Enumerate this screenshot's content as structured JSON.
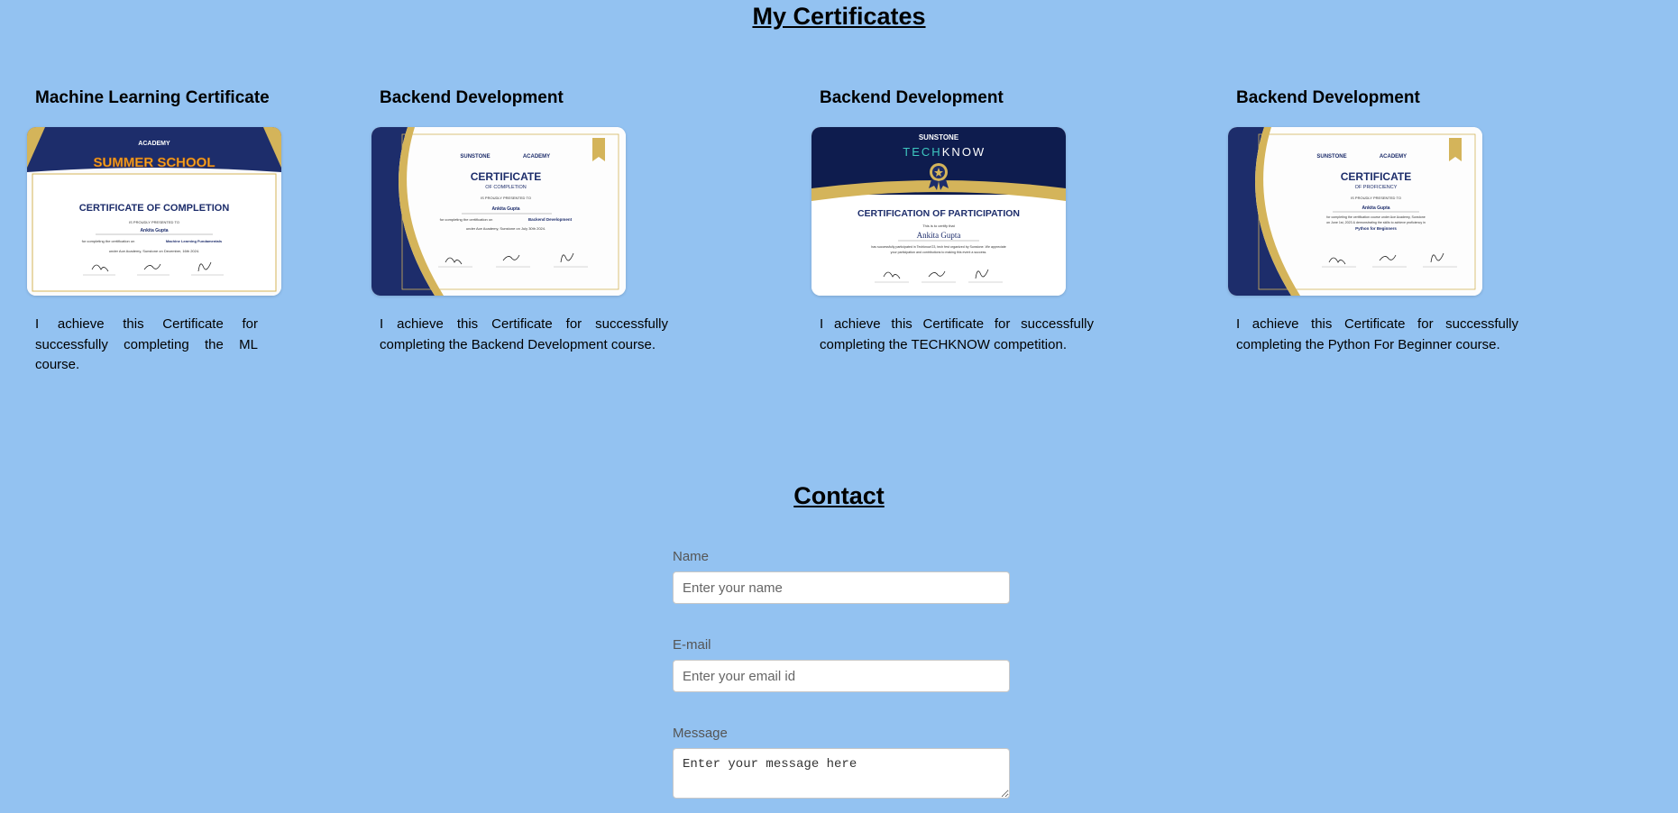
{
  "certificates_section": {
    "title": "My Certificates",
    "cards": [
      {
        "title": "Machine Learning Certificate",
        "description": "I achieve this Certificate for successfully completing the ML course.",
        "image": {
          "brand": "ACADEMY",
          "banner": "SUMMER SCHOOL",
          "heading": "CERTIFICATE OF COMPLETION",
          "presented": "IS PROUDLY PRESENTED TO",
          "name": "Ankita Gupta",
          "line": "for completing the certification on",
          "course": "Machine Learning Fundamentals",
          "footer": "under Ace Academy, Sunstone on December, 16th 2024."
        }
      },
      {
        "title": "Backend Development",
        "description": "I achieve this Certificate for successfully completing the Backend Development course.",
        "image": {
          "brand_left": "SUNSTONE",
          "brand_right": "ACADEMY",
          "heading": "CERTIFICATE",
          "subheading": "OF COMPLETION",
          "presented": "IS PROUDLY PRESENTED TO",
          "name": "Ankita Gupta",
          "line": "for completing the certification on",
          "course": "Backend Development",
          "footer": "under Ace Academy, Sunstone on July 30th 2024."
        }
      },
      {
        "title": "Backend Development",
        "description": "I achieve this Certificate for successfully completing the TECHKNOW competition.",
        "image": {
          "brand": "SUNSTONE",
          "event_a": "TECH",
          "event_b": "KNOW",
          "heading": "CERTIFICATION OF PARTICIPATION",
          "presented": "This is to certify that",
          "name": "Ankita Gupta",
          "line": "has successfully participated in Techknow'23, tech fest organized by Sunstone. We appreciate",
          "line2": "your participation and contributions to making this event a success."
        }
      },
      {
        "title": "Backend Development",
        "description": "I achieve this Certificate for successfully completing the Python For Beginner course.",
        "image": {
          "brand_left": "SUNSTONE",
          "brand_right": "ACADEMY",
          "heading": "CERTIFICATE",
          "subheading": "OF PROFICIENCY",
          "presented": "IS PROUDLY PRESENTED TO",
          "name": "Ankita Gupta",
          "line": "for completing the certification course under Ace Academy, Sunstone",
          "line2": "on June 1st, 2023 & demonstrating the skills to achieve proficiency in",
          "course": "Python for Beginners"
        }
      }
    ]
  },
  "contact_section": {
    "title": "Contact",
    "name_label": "Name",
    "name_placeholder": "Enter your name",
    "email_label": "E-mail",
    "email_placeholder": "Enter your email id",
    "message_label": "Message",
    "message_placeholder": "Enter your message here"
  },
  "colors": {
    "page_background": "#93c2f1",
    "certificate_navy": "#1d2d6b",
    "certificate_gold": "#d4b45a"
  },
  "icons": [
    "textarea-resize-handle-icon",
    "seal-medal-icon",
    "ribbon-icon"
  ]
}
